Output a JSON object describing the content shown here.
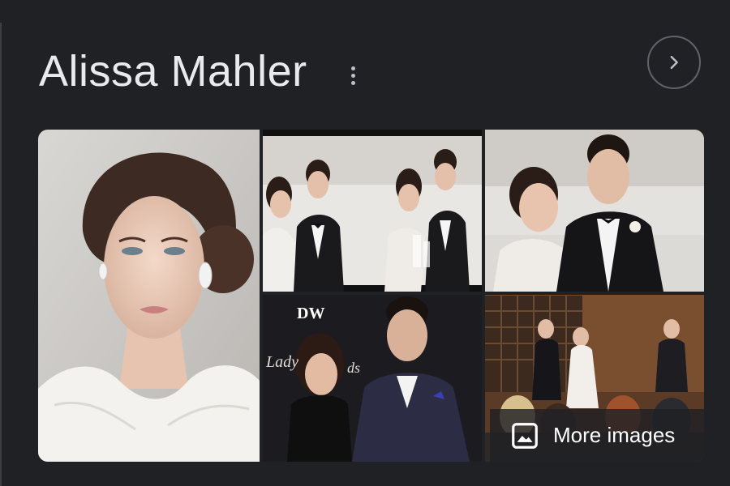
{
  "header": {
    "title": "Alissa Mahler",
    "menu_icon": "more-vert-icon",
    "next_icon": "chevron-right-icon"
  },
  "images": [
    {
      "name": "bride-portrait",
      "alt": ""
    },
    {
      "name": "couple-laughing",
      "alt": ""
    },
    {
      "name": "couple-waterfront",
      "alt": ""
    },
    {
      "name": "couple-red-carpet",
      "alt": "",
      "logo_text": "DW",
      "backdrop_text": "Lady",
      "backdrop_text_2": "ds"
    },
    {
      "name": "wedding-ceremony",
      "alt": ""
    }
  ],
  "more_images": {
    "label": "More images",
    "icon": "image-icon"
  },
  "colors": {
    "background": "#202124",
    "text": "#e8eaed",
    "border": "#5f6368"
  }
}
